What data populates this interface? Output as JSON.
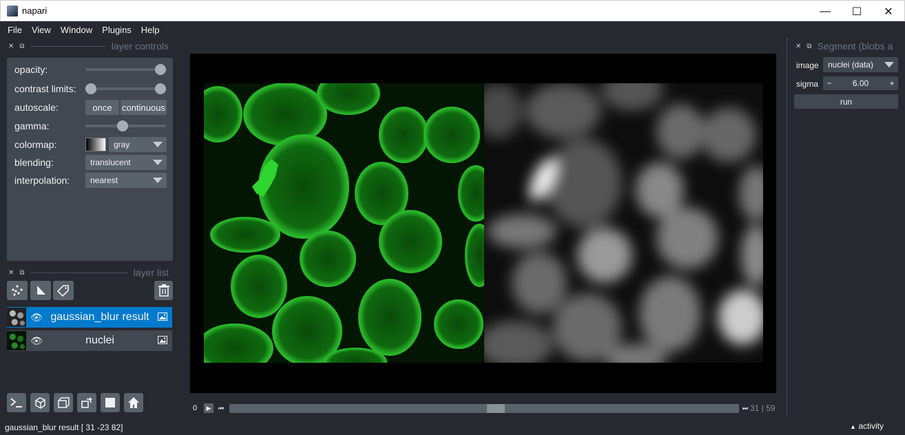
{
  "window": {
    "title": "napari"
  },
  "menu": [
    "File",
    "View",
    "Window",
    "Plugins",
    "Help"
  ],
  "layer_controls": {
    "title": "layer controls",
    "opacity_label": "opacity:",
    "contrast_label": "contrast limits:",
    "autoscale_label": "autoscale:",
    "autoscale_once": "once",
    "autoscale_continuous": "continuous",
    "gamma_label": "gamma:",
    "colormap_label": "colormap:",
    "colormap_value": "gray",
    "blending_label": "blending:",
    "blending_value": "translucent",
    "interpolation_label": "interpolation:",
    "interpolation_value": "nearest",
    "opacity_value": 1.0,
    "gamma_value": 0.5
  },
  "layer_list": {
    "title": "layer list",
    "layers": [
      {
        "name": "gaussian_blur result",
        "selected": true
      },
      {
        "name": "nuclei",
        "selected": false
      }
    ]
  },
  "dims": {
    "current": "0",
    "count": "31 | 59"
  },
  "plugin": {
    "title": "Segment (blobs a",
    "image_label": "image",
    "image_value": "nuclei (data)",
    "sigma_label": "sigma",
    "sigma_value": "6.00",
    "run_label": "run"
  },
  "status": {
    "text": "gaussian_blur result [ 31 -23  82]",
    "activity": "activity"
  },
  "colors": {
    "bg": "#262930",
    "panel": "#414851",
    "control": "#5a626c",
    "selected": "#007acc",
    "green": "#2fd62f"
  },
  "icons": [
    "console-icon",
    "ndisplay-icon",
    "roll-icon",
    "transpose-icon",
    "grid-icon",
    "home-icon",
    "points-icon",
    "shapes-icon",
    "labels-icon",
    "delete-icon",
    "eye-icon",
    "image-icon"
  ]
}
